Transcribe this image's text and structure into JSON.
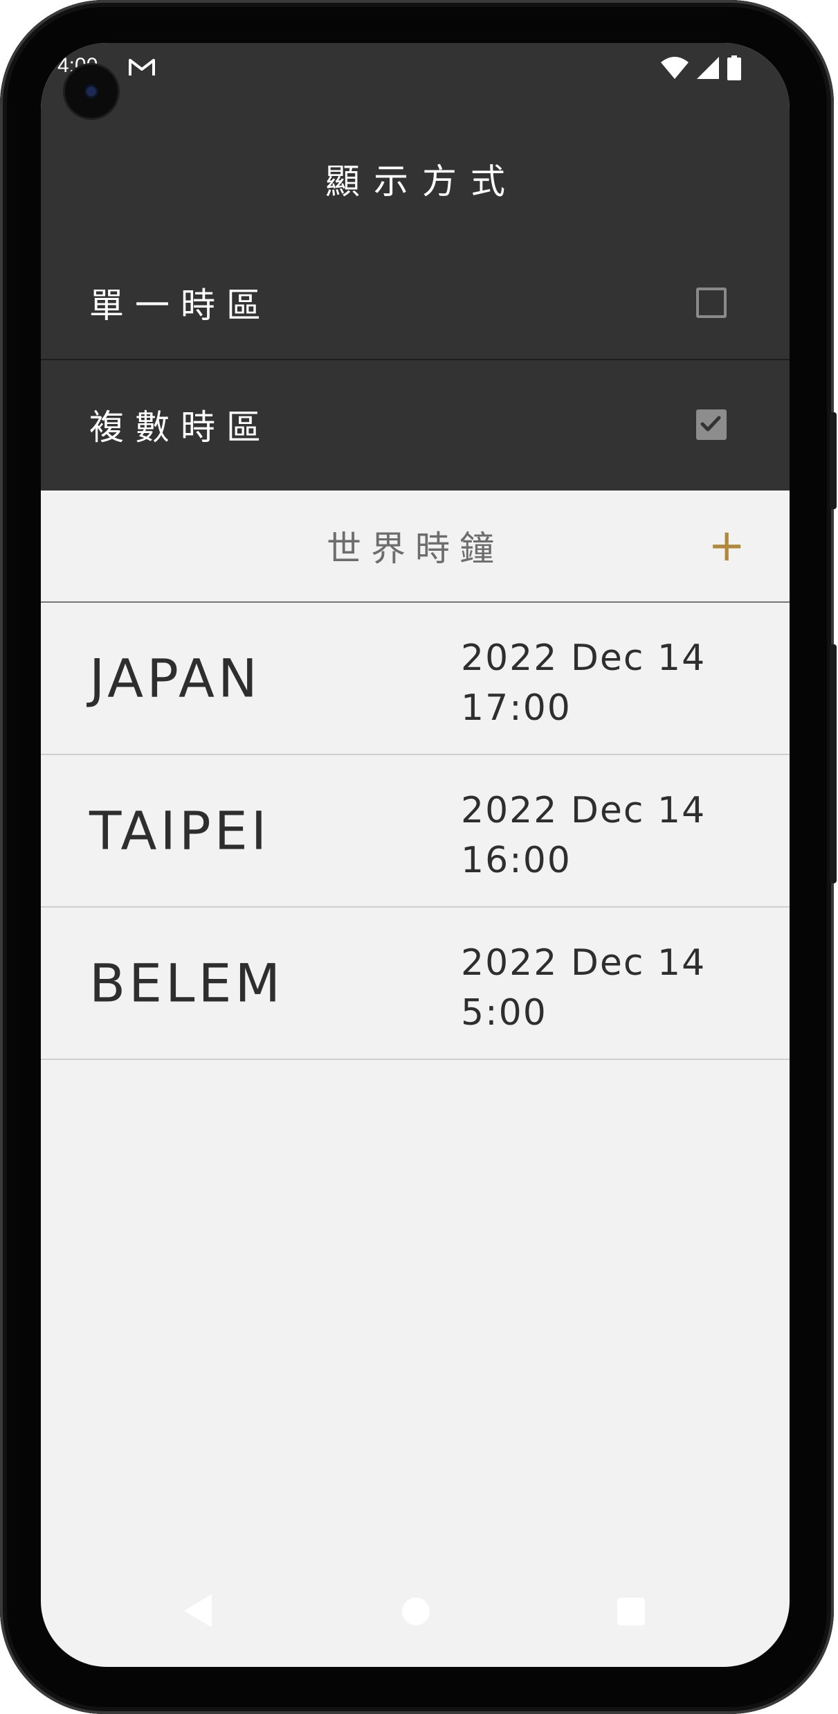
{
  "status_bar": {
    "time": "4:00"
  },
  "settings": {
    "title": "顯示方式",
    "options": [
      {
        "label": "單一時區",
        "checked": false
      },
      {
        "label": "複數時區",
        "checked": true
      }
    ]
  },
  "world_clock": {
    "title": "世界時鐘",
    "add_label": "+",
    "rows": [
      {
        "city": "JAPAN",
        "date": "2022 Dec 14",
        "time": "17:00"
      },
      {
        "city": "TAIPEI",
        "date": "2022 Dec 14",
        "time": "16:00"
      },
      {
        "city": "BELEM",
        "date": "2022 Dec 14",
        "time": "5:00"
      }
    ]
  },
  "colors": {
    "accent": "#b08a3a",
    "dark_panel": "#333333",
    "list_bg": "#f2f2f2"
  }
}
